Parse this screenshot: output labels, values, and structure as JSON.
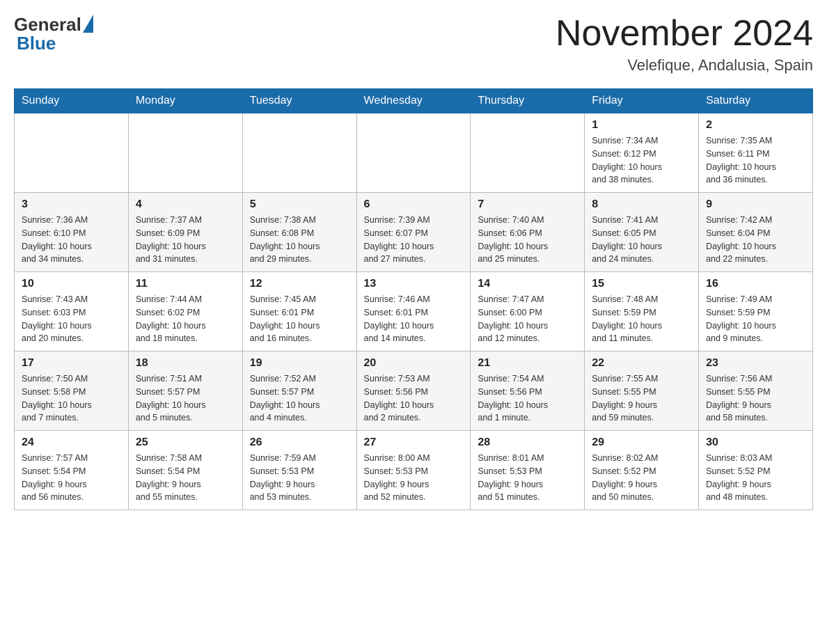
{
  "header": {
    "logo_general": "General",
    "logo_blue": "Blue",
    "title": "November 2024",
    "subtitle": "Velefique, Andalusia, Spain"
  },
  "weekdays": [
    "Sunday",
    "Monday",
    "Tuesday",
    "Wednesday",
    "Thursday",
    "Friday",
    "Saturday"
  ],
  "weeks": [
    [
      {
        "day": "",
        "info": ""
      },
      {
        "day": "",
        "info": ""
      },
      {
        "day": "",
        "info": ""
      },
      {
        "day": "",
        "info": ""
      },
      {
        "day": "",
        "info": ""
      },
      {
        "day": "1",
        "info": "Sunrise: 7:34 AM\nSunset: 6:12 PM\nDaylight: 10 hours\nand 38 minutes."
      },
      {
        "day": "2",
        "info": "Sunrise: 7:35 AM\nSunset: 6:11 PM\nDaylight: 10 hours\nand 36 minutes."
      }
    ],
    [
      {
        "day": "3",
        "info": "Sunrise: 7:36 AM\nSunset: 6:10 PM\nDaylight: 10 hours\nand 34 minutes."
      },
      {
        "day": "4",
        "info": "Sunrise: 7:37 AM\nSunset: 6:09 PM\nDaylight: 10 hours\nand 31 minutes."
      },
      {
        "day": "5",
        "info": "Sunrise: 7:38 AM\nSunset: 6:08 PM\nDaylight: 10 hours\nand 29 minutes."
      },
      {
        "day": "6",
        "info": "Sunrise: 7:39 AM\nSunset: 6:07 PM\nDaylight: 10 hours\nand 27 minutes."
      },
      {
        "day": "7",
        "info": "Sunrise: 7:40 AM\nSunset: 6:06 PM\nDaylight: 10 hours\nand 25 minutes."
      },
      {
        "day": "8",
        "info": "Sunrise: 7:41 AM\nSunset: 6:05 PM\nDaylight: 10 hours\nand 24 minutes."
      },
      {
        "day": "9",
        "info": "Sunrise: 7:42 AM\nSunset: 6:04 PM\nDaylight: 10 hours\nand 22 minutes."
      }
    ],
    [
      {
        "day": "10",
        "info": "Sunrise: 7:43 AM\nSunset: 6:03 PM\nDaylight: 10 hours\nand 20 minutes."
      },
      {
        "day": "11",
        "info": "Sunrise: 7:44 AM\nSunset: 6:02 PM\nDaylight: 10 hours\nand 18 minutes."
      },
      {
        "day": "12",
        "info": "Sunrise: 7:45 AM\nSunset: 6:01 PM\nDaylight: 10 hours\nand 16 minutes."
      },
      {
        "day": "13",
        "info": "Sunrise: 7:46 AM\nSunset: 6:01 PM\nDaylight: 10 hours\nand 14 minutes."
      },
      {
        "day": "14",
        "info": "Sunrise: 7:47 AM\nSunset: 6:00 PM\nDaylight: 10 hours\nand 12 minutes."
      },
      {
        "day": "15",
        "info": "Sunrise: 7:48 AM\nSunset: 5:59 PM\nDaylight: 10 hours\nand 11 minutes."
      },
      {
        "day": "16",
        "info": "Sunrise: 7:49 AM\nSunset: 5:59 PM\nDaylight: 10 hours\nand 9 minutes."
      }
    ],
    [
      {
        "day": "17",
        "info": "Sunrise: 7:50 AM\nSunset: 5:58 PM\nDaylight: 10 hours\nand 7 minutes."
      },
      {
        "day": "18",
        "info": "Sunrise: 7:51 AM\nSunset: 5:57 PM\nDaylight: 10 hours\nand 5 minutes."
      },
      {
        "day": "19",
        "info": "Sunrise: 7:52 AM\nSunset: 5:57 PM\nDaylight: 10 hours\nand 4 minutes."
      },
      {
        "day": "20",
        "info": "Sunrise: 7:53 AM\nSunset: 5:56 PM\nDaylight: 10 hours\nand 2 minutes."
      },
      {
        "day": "21",
        "info": "Sunrise: 7:54 AM\nSunset: 5:56 PM\nDaylight: 10 hours\nand 1 minute."
      },
      {
        "day": "22",
        "info": "Sunrise: 7:55 AM\nSunset: 5:55 PM\nDaylight: 9 hours\nand 59 minutes."
      },
      {
        "day": "23",
        "info": "Sunrise: 7:56 AM\nSunset: 5:55 PM\nDaylight: 9 hours\nand 58 minutes."
      }
    ],
    [
      {
        "day": "24",
        "info": "Sunrise: 7:57 AM\nSunset: 5:54 PM\nDaylight: 9 hours\nand 56 minutes."
      },
      {
        "day": "25",
        "info": "Sunrise: 7:58 AM\nSunset: 5:54 PM\nDaylight: 9 hours\nand 55 minutes."
      },
      {
        "day": "26",
        "info": "Sunrise: 7:59 AM\nSunset: 5:53 PM\nDaylight: 9 hours\nand 53 minutes."
      },
      {
        "day": "27",
        "info": "Sunrise: 8:00 AM\nSunset: 5:53 PM\nDaylight: 9 hours\nand 52 minutes."
      },
      {
        "day": "28",
        "info": "Sunrise: 8:01 AM\nSunset: 5:53 PM\nDaylight: 9 hours\nand 51 minutes."
      },
      {
        "day": "29",
        "info": "Sunrise: 8:02 AM\nSunset: 5:52 PM\nDaylight: 9 hours\nand 50 minutes."
      },
      {
        "day": "30",
        "info": "Sunrise: 8:03 AM\nSunset: 5:52 PM\nDaylight: 9 hours\nand 48 minutes."
      }
    ]
  ]
}
